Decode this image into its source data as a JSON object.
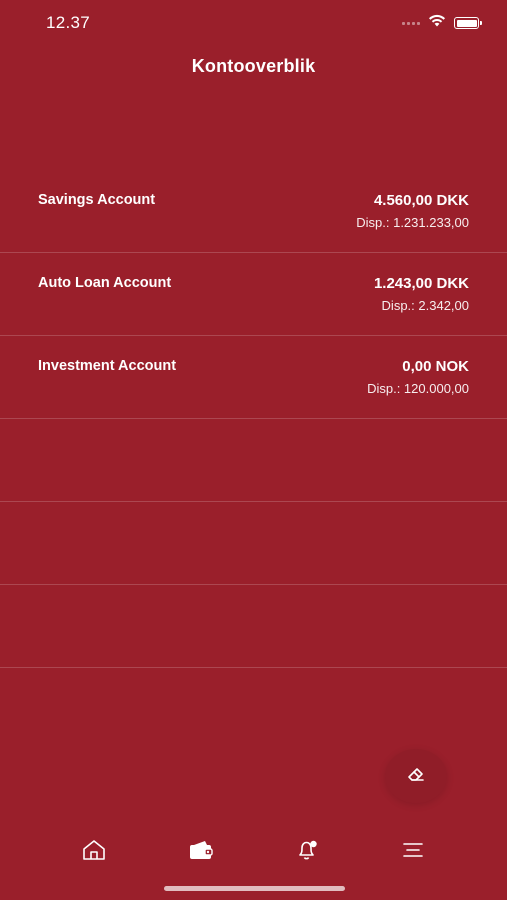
{
  "status_bar": {
    "time": "12.37"
  },
  "header": {
    "title": "Kontooverblik"
  },
  "accounts": [
    {
      "name": "Savings Account",
      "balance": "4.560,00 DKK",
      "available": "Disp.: 1.231.233,00"
    },
    {
      "name": "Auto Loan Account",
      "balance": "1.243,00 DKK",
      "available": "Disp.: 2.342,00"
    },
    {
      "name": "Investment Account",
      "balance": "0,00 NOK",
      "available": "Disp.: 120.000,00"
    }
  ],
  "icons": {
    "fab": "eraser-icon",
    "tabs": [
      "home-icon",
      "wallet-icon",
      "notification-bell-icon",
      "menu-icon"
    ]
  },
  "colors": {
    "background": "#9A1F2B",
    "text": "#FFFFFF"
  }
}
